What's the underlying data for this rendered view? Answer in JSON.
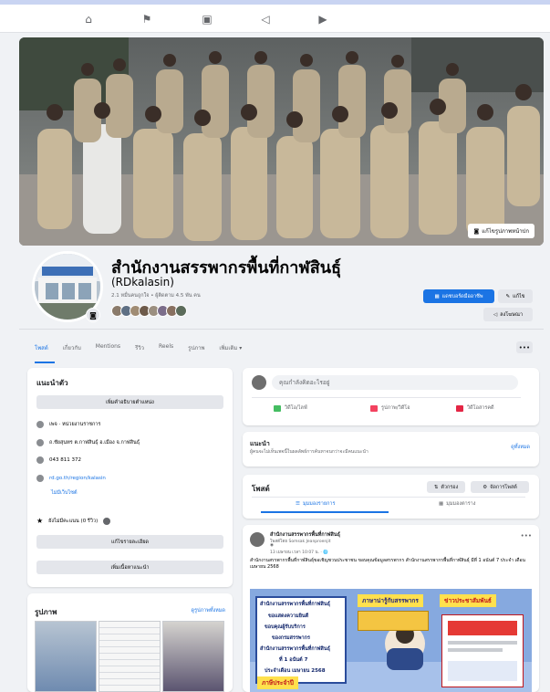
{
  "nav": {
    "icons": [
      "home-icon",
      "flag-icon",
      "marketplace-icon",
      "megaphone-icon",
      "video-icon"
    ]
  },
  "cover": {
    "edit_button": "แก้ไขรูปภาพหน้าปก"
  },
  "page": {
    "name": "สำนักงานสรรพากรพื้นที่กาฬสินธุ์",
    "handle": "(RDkalasin)",
    "stats": "2.1 หมื่นคนถูกใจ • ผู้ติดตาม 4.5 พัน คน",
    "primary_action": "แดชบอร์ดมืออาชีพ",
    "edit_label": "แก้ไข",
    "ads_label": "ลงโฆษณา"
  },
  "tabs": {
    "items": [
      "โพสต์",
      "เกี่ยวกับ",
      "Mentions",
      "รีวิว",
      "Reels",
      "รูปภาพ",
      "เพิ่มเติม ▾"
    ],
    "more_label": "•••"
  },
  "intro": {
    "title": "แนะนำตัว",
    "add_bio": "เพิ่มคำอธิบายตำแหน่ง",
    "category": "เพจ · หน่วยงานราชการ",
    "address": "ถ.ชัยสุนทร ต.กาฬสินธุ์ อ.เมือง จ.กาฬสินธุ์",
    "phone": "043 811 372",
    "website": "rd.go.th/region/kalasin",
    "website_btn": "ไม่มีเว็บไซต์",
    "rating": "ยังไม่มีคะแนน (0 รีวิว)",
    "edit_details": "แก้ไขรายละเอียด",
    "add_featured": "เพิ่มเนื้อหาแนะนำ"
  },
  "photos": {
    "title": "รูปภาพ",
    "see_all": "ดูรูปภาพทั้งหมด"
  },
  "composer": {
    "placeholder": "คุณกำลังคิดอะไรอยู่",
    "actions": [
      "วิดีโอ/ไลฟ์",
      "รูปภาพ/วิดีโอ",
      "วิดีโอสารคดี"
    ]
  },
  "recommend": {
    "title": "แนะนำ",
    "subtitle": "ผู้คนจะไม่เห็นเพจนี้ในผลลัพธ์การค้นหาจนกว่าจะมีคนแนะนำ",
    "link": "ดูทั้งหมด"
  },
  "posts": {
    "title": "โพสต์",
    "filter": "ตัวกรอง",
    "manage": "จัดการโพสต์",
    "tab_list": "มุมมองรายการ",
    "tab_grid": "มุมมองตาราง"
  },
  "post": {
    "author": "สำนักงานสรรพากรพื้นที่กาฬสินธุ์",
    "sub1": "โพสต์โดย Somsak Jeanproenjit",
    "time": "13 เมษายน เวลา 10:07 น. · 🌐",
    "text": "สำนักงานสรรพากรพื้นที่กาฬสินธุ์ขอเชิญชวนประชาชน ขอบคุณข้อมูลสรรพากร สำนักงานสรรพากรพื้นที่กาฬสินธุ์ มีที่ 1 อนันต์ 7 ประจำ เดือน เมษายน 2568"
  },
  "poster": {
    "lines": [
      "สำนักงานสรรพากรพื้นที่กาฬสินธุ์",
      "ขอแสดงความยินดี",
      "ขอบคุณผู้รับบริการ",
      "ของกรมสรรพากร",
      "สำนักงานสรรพากรพื้นที่กาฬสินธุ์",
      "ที่ 1 อนันต์ 7",
      "ประจำเดือน เมษายน 2568"
    ],
    "tag1": "ภาษาน่ารู้กับสรรพากร",
    "tag2": "ข่าวประชาสัมพันธ์",
    "tag3": "ภาษีประจำปี"
  },
  "colors": {
    "accent": "#1b74e4",
    "background": "#f0f2f5"
  }
}
